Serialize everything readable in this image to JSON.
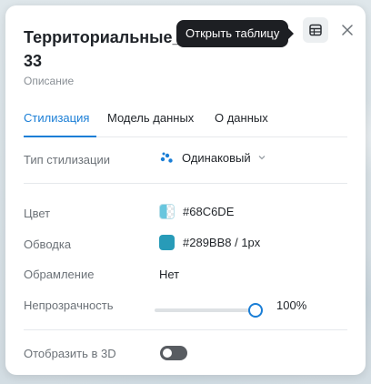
{
  "header": {
    "title_line1": "Территориальные_з",
    "title_line2": "33",
    "tooltip": "Открыть таблицу",
    "table_icon": "table-icon",
    "close_icon": "close-icon"
  },
  "description": "Описание",
  "tabs": [
    {
      "label": "Стилизация",
      "active": true
    },
    {
      "label": "Модель данных",
      "active": false
    },
    {
      "label": "О данных",
      "active": false
    }
  ],
  "styling_type": {
    "label": "Тип стилизации",
    "value": "Одинаковый",
    "icon": "dots-icon",
    "chevron": "chevron-down-icon"
  },
  "color": {
    "label": "Цвет",
    "value": "#68C6DE",
    "swatch": "#68C6DE"
  },
  "stroke": {
    "label": "Обводка",
    "value": "#289BB8 / 1px",
    "swatch": "#289BB8"
  },
  "frame": {
    "label": "Обрамление",
    "value": "Нет"
  },
  "opacity": {
    "label": "Непрозрачность",
    "value": "100%",
    "level": 1.0
  },
  "show3d": {
    "label": "Отобразить в 3D",
    "enabled": false
  },
  "colors": {
    "accent": "#1A7ED6",
    "tooltip_bg": "#1D1F23",
    "toggle_off": "#585C61"
  }
}
